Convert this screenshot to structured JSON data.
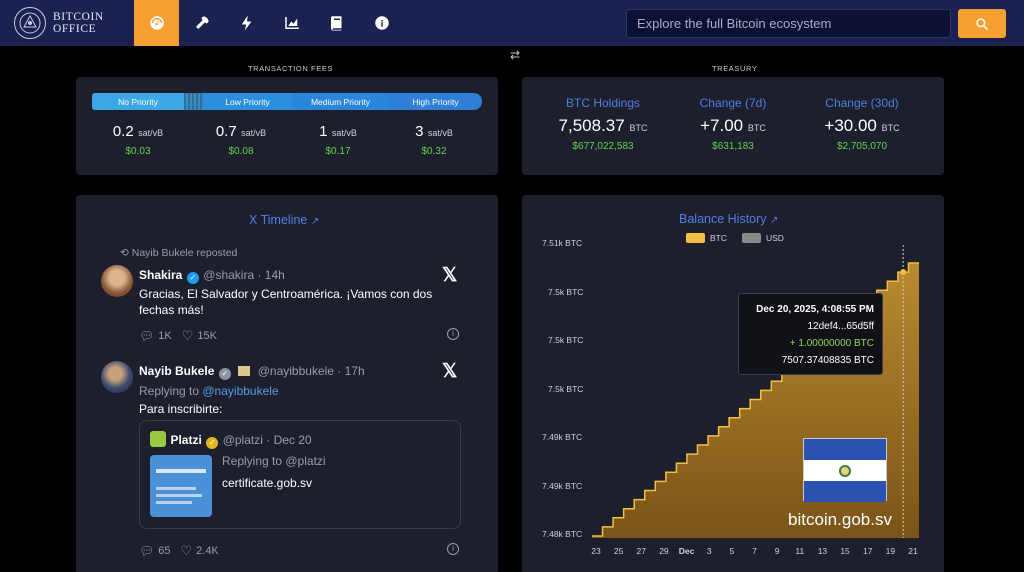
{
  "header": {
    "logo_line1": "BITCOIN",
    "logo_line2": "OFFICE",
    "nav_items": [
      {
        "icon": "dashboard-gauge-icon",
        "active": true
      },
      {
        "icon": "mining-pickaxe-icon",
        "active": false
      },
      {
        "icon": "lightning-icon",
        "active": false
      },
      {
        "icon": "chart-icon",
        "active": false
      },
      {
        "icon": "book-icon",
        "active": false
      },
      {
        "icon": "info-icon",
        "active": false
      }
    ],
    "search_placeholder": "Explore the full Bitcoin ecosystem",
    "accent_color": "#f7a032"
  },
  "fees": {
    "section_label": "TRANSACTION FEES",
    "priority_labels": [
      "No Priority",
      "Low Priority",
      "Medium Priority",
      "High Priority"
    ],
    "items": [
      {
        "value": "0.2",
        "unit": "sat/vB",
        "usd": "$0.03"
      },
      {
        "value": "0.7",
        "unit": "sat/vB",
        "usd": "$0.08"
      },
      {
        "value": "1",
        "unit": "sat/vB",
        "usd": "$0.17"
      },
      {
        "value": "3",
        "unit": "sat/vB",
        "usd": "$0.32"
      }
    ]
  },
  "treasury": {
    "section_label": "TREASURY",
    "items": [
      {
        "heading": "BTC Holdings",
        "value": "7,508.37",
        "unit": "BTC",
        "usd": "$677,022,583"
      },
      {
        "heading": "Change (7d)",
        "value": "+7.00",
        "unit": "BTC",
        "usd": "$631,183"
      },
      {
        "heading": "Change (30d)",
        "value": "+30.00",
        "unit": "BTC",
        "usd": "$2,705,070"
      }
    ]
  },
  "timeline": {
    "title": "X Timeline",
    "repost_label": "Nayib Bukele reposted",
    "tweets": [
      {
        "name": "Shakira",
        "handle": "@shakira · 14h",
        "body": "Gracias, El Salvador y Centroamérica. ¡Vamos con dos fechas más!",
        "replies": "1K",
        "likes": "15K"
      },
      {
        "name": "Nayib Bukele",
        "handle": "@nayibbukele · 17h",
        "replying_prefix": "Replying to ",
        "replying_to": "@nayibbukele",
        "body": "Para inscribirte:",
        "replies": "65",
        "likes": "2.4K",
        "quote": {
          "name": "Platzi",
          "handle": "@platzi · Dec 20",
          "replying": "Replying to @platzi",
          "link": "certificate.gob.sv"
        }
      }
    ]
  },
  "balance": {
    "title": "Balance History",
    "legend": [
      {
        "label": "BTC",
        "color": "#f5c042"
      },
      {
        "label": "USD",
        "color": "#8a8a8a"
      }
    ],
    "tooltip": {
      "date": "Dec 20, 2025, 4:08:55 PM",
      "tx": "12def4...65d5ff",
      "change": "+ 1.00000000 BTC",
      "balance": "7507.37408835 BTC"
    },
    "watermark": "bitcoin.gob.sv"
  },
  "chart_data": {
    "type": "area",
    "title": "Balance History",
    "x_ticks": [
      "23",
      "25",
      "27",
      "29",
      "Dec",
      "3",
      "5",
      "7",
      "9",
      "11",
      "13",
      "15",
      "17",
      "19",
      "21"
    ],
    "y_ticks": [
      "7.51k BTC",
      "7.5k BTC",
      "7.5k BTC",
      "7.5k BTC",
      "7.49k BTC",
      "7.49k BTC",
      "7.48k BTC"
    ],
    "series": [
      {
        "name": "BTC",
        "values": [
          7478.37,
          7479.37,
          7480.37,
          7481.37,
          7482.37,
          7483.37,
          7484.37,
          7485.37,
          7486.37,
          7487.37,
          7488.37,
          7489.37,
          7490.37,
          7491.37,
          7492.37,
          7493.37,
          7494.37,
          7495.37,
          7496.37,
          7497.37,
          7498.37,
          7499.37,
          7500.37,
          7501.37,
          7502.37,
          7503.37,
          7504.37,
          7505.37,
          7506.37,
          7507.37,
          7508.37
        ]
      }
    ],
    "ylim": [
      7478.37,
      7508.37
    ],
    "grid": false,
    "legend_position": "top"
  }
}
